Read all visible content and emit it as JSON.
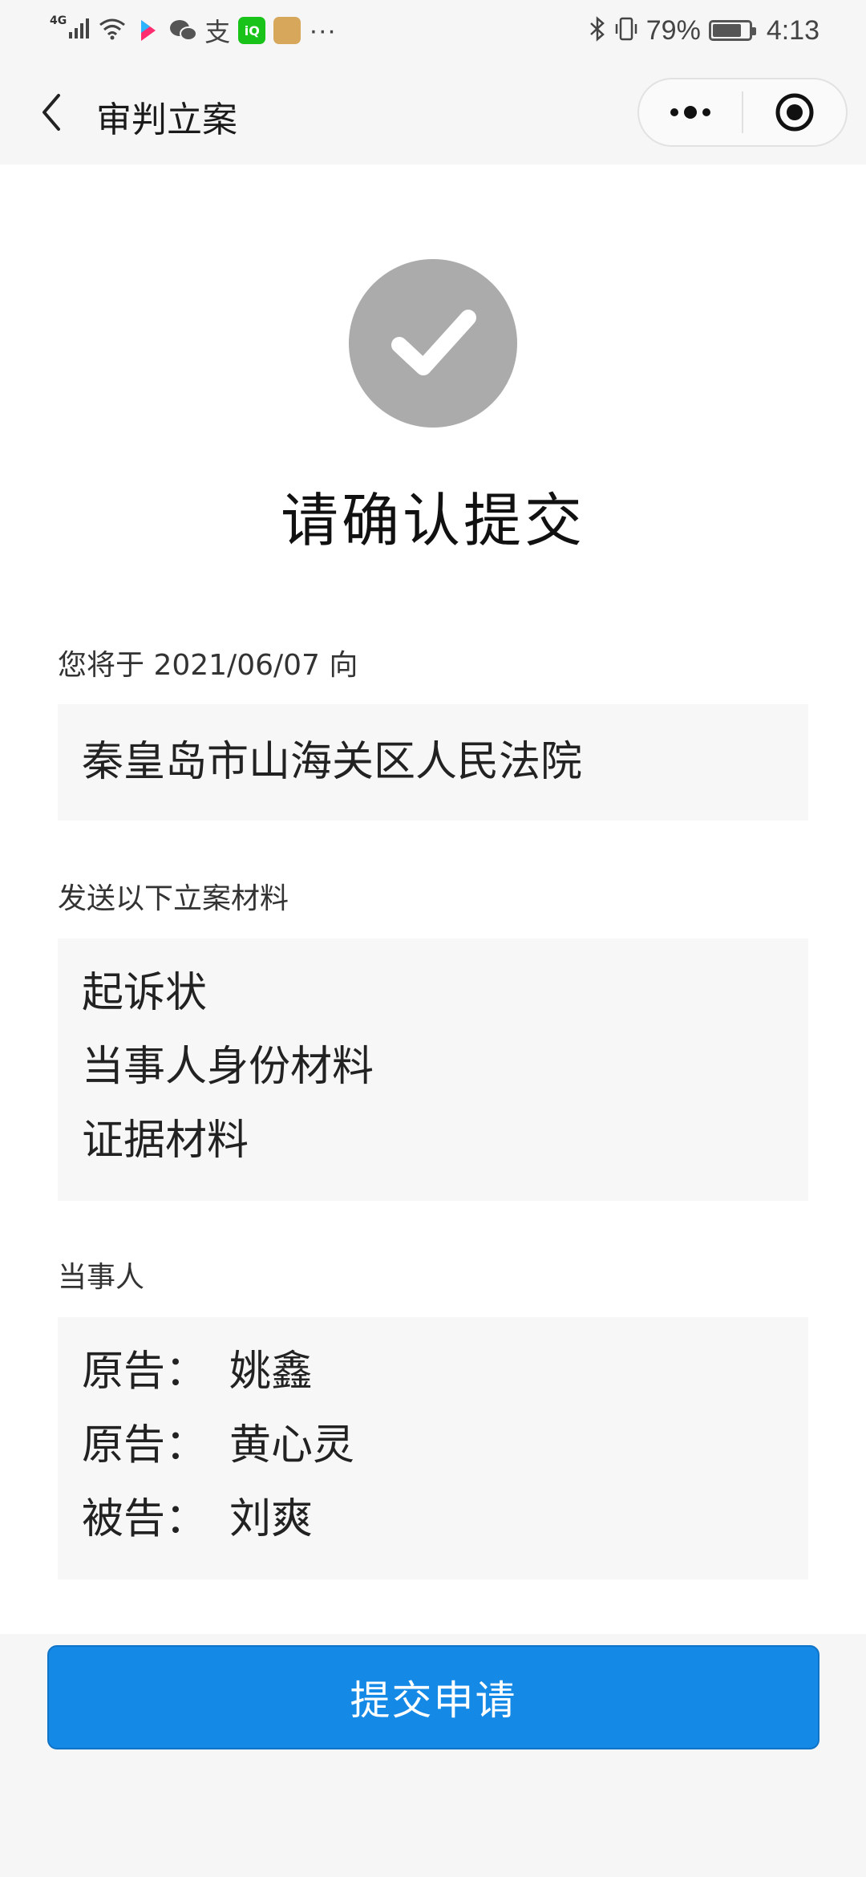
{
  "status_bar": {
    "network": "4G",
    "more": "···",
    "battery_percent": "79%",
    "battery_level": 0.79,
    "time": "4:13",
    "app_icons": [
      "youku-icon",
      "wechat-icon",
      "alipay-icon",
      "iqiyi-icon",
      "app-icon"
    ]
  },
  "nav": {
    "title": "审判立案"
  },
  "confirm": {
    "title": "请确认提交",
    "date_line": "您将于 2021/06/07 向",
    "court": "秦皇岛市山海关区人民法院",
    "materials_label": "发送以下立案材料",
    "materials": [
      "起诉状",
      "当事人身份材料",
      "证据材料"
    ],
    "parties_label": "当事人",
    "parties": [
      {
        "role": "原告：",
        "name": "姚鑫"
      },
      {
        "role": "原告：",
        "name": "黄心灵"
      },
      {
        "role": "被告：",
        "name": "刘爽"
      }
    ]
  },
  "submit_label": "提交申请",
  "colors": {
    "accent": "#1589e6",
    "check_circle": "#ababab",
    "page_bg": "#f6f6f6",
    "box_bg": "#f7f7f7"
  }
}
